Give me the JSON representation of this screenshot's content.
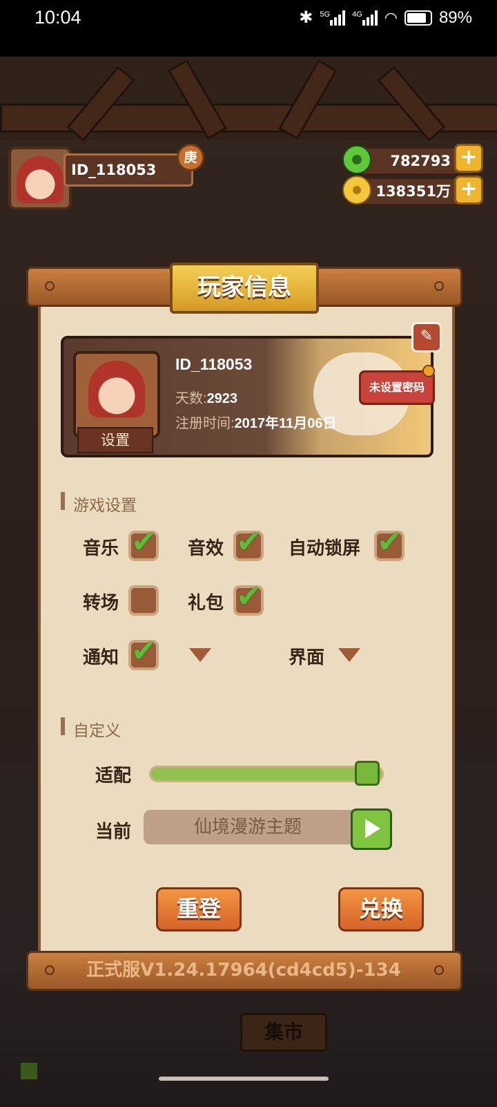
{
  "status_bar": {
    "time": "10:04",
    "net1": "5G",
    "net2": "4G",
    "battery": "89%"
  },
  "hud": {
    "player_id": "ID_118053",
    "badge": "庚",
    "jade": "782793",
    "coins": "138351万"
  },
  "panel": {
    "title": "玩家信息",
    "profile": {
      "id": "ID_118053",
      "days_label": "天数:",
      "days": "2923",
      "reg_label": "注册时间:",
      "reg_date": "2017年11月06日",
      "set_button": "设置",
      "password_button": "未设置密码"
    },
    "game_settings": {
      "title": "游戏设置",
      "options": [
        {
          "label": "音乐",
          "checked": true
        },
        {
          "label": "音效",
          "checked": true
        },
        {
          "label": "自动锁屏",
          "checked": true
        },
        {
          "label": "转场",
          "checked": false
        },
        {
          "label": "礼包",
          "checked": true
        },
        {
          "label": "通知",
          "checked": true
        }
      ],
      "interface_label": "界面"
    },
    "custom": {
      "title": "自定义",
      "fit_label": "适配",
      "fit_level": 0.96,
      "current_label": "当前",
      "current_theme": "仙境漫游主题"
    },
    "buttons": {
      "relogin": "重登",
      "exchange": "兑换"
    },
    "version": "正式服V1.24.17964(cd4cd5)-134"
  },
  "background": {
    "market": "集市"
  }
}
